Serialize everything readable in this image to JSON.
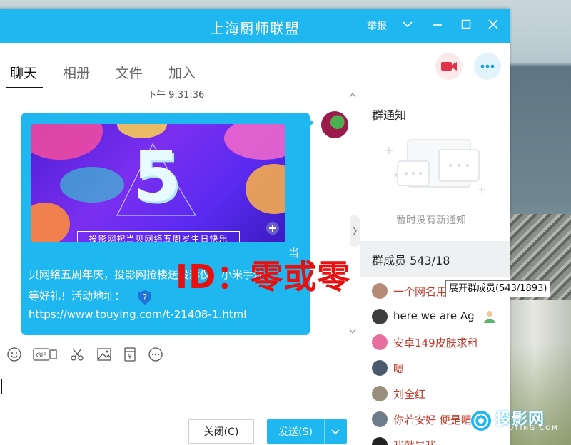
{
  "window": {
    "title": "上海厨师联盟",
    "report_label": "举报"
  },
  "tabs": [
    {
      "label": "聊天",
      "active": true
    },
    {
      "label": "相册",
      "active": false
    },
    {
      "label": "文件",
      "active": false
    },
    {
      "label": "加入",
      "active": false
    }
  ],
  "chat": {
    "timestamp": "下午 9:31:36",
    "banner_caption": "投影网祝当贝网络五周岁生日快乐",
    "message_lines": [
      "当",
      "贝网络五周年庆，投影网抢楼送投影仪、小米手环",
      "等好礼！活动地址："
    ],
    "link": "https://www.touying.com/t-21408-1.html",
    "watermark": "ID：零或零"
  },
  "toolbar": {
    "icons": [
      "emoji-icon",
      "gif-icon",
      "scissors-icon",
      "image-icon",
      "red-packet-icon",
      "more-icon"
    ]
  },
  "buttons": {
    "close": "关闭(C)",
    "send": "发送(S)"
  },
  "side": {
    "notice_title": "群通知",
    "notice_empty": "暂时没有新通知",
    "members_title": "群成员 543/18",
    "tooltip": "展开群成员(543/1893)",
    "members": [
      {
        "name": "一个网名用",
        "color": "#c0392b"
      },
      {
        "name": "here we are Ag",
        "color": "#222222"
      },
      {
        "name": "安卓149皮肤求租",
        "color": "#c0392b"
      },
      {
        "name": "嗯",
        "color": "#c0392b"
      },
      {
        "name": "刘全红",
        "color": "#c0392b"
      },
      {
        "name": "你若安好 便是晴天",
        "color": "#c0392b"
      },
      {
        "name": "我就是我",
        "color": "#c0392b"
      }
    ]
  },
  "site_logo": {
    "name": "投影网",
    "domain": "TOUYING.COM"
  },
  "colors": {
    "accent": "#1eb7ef",
    "watermark": "#e8100f"
  }
}
